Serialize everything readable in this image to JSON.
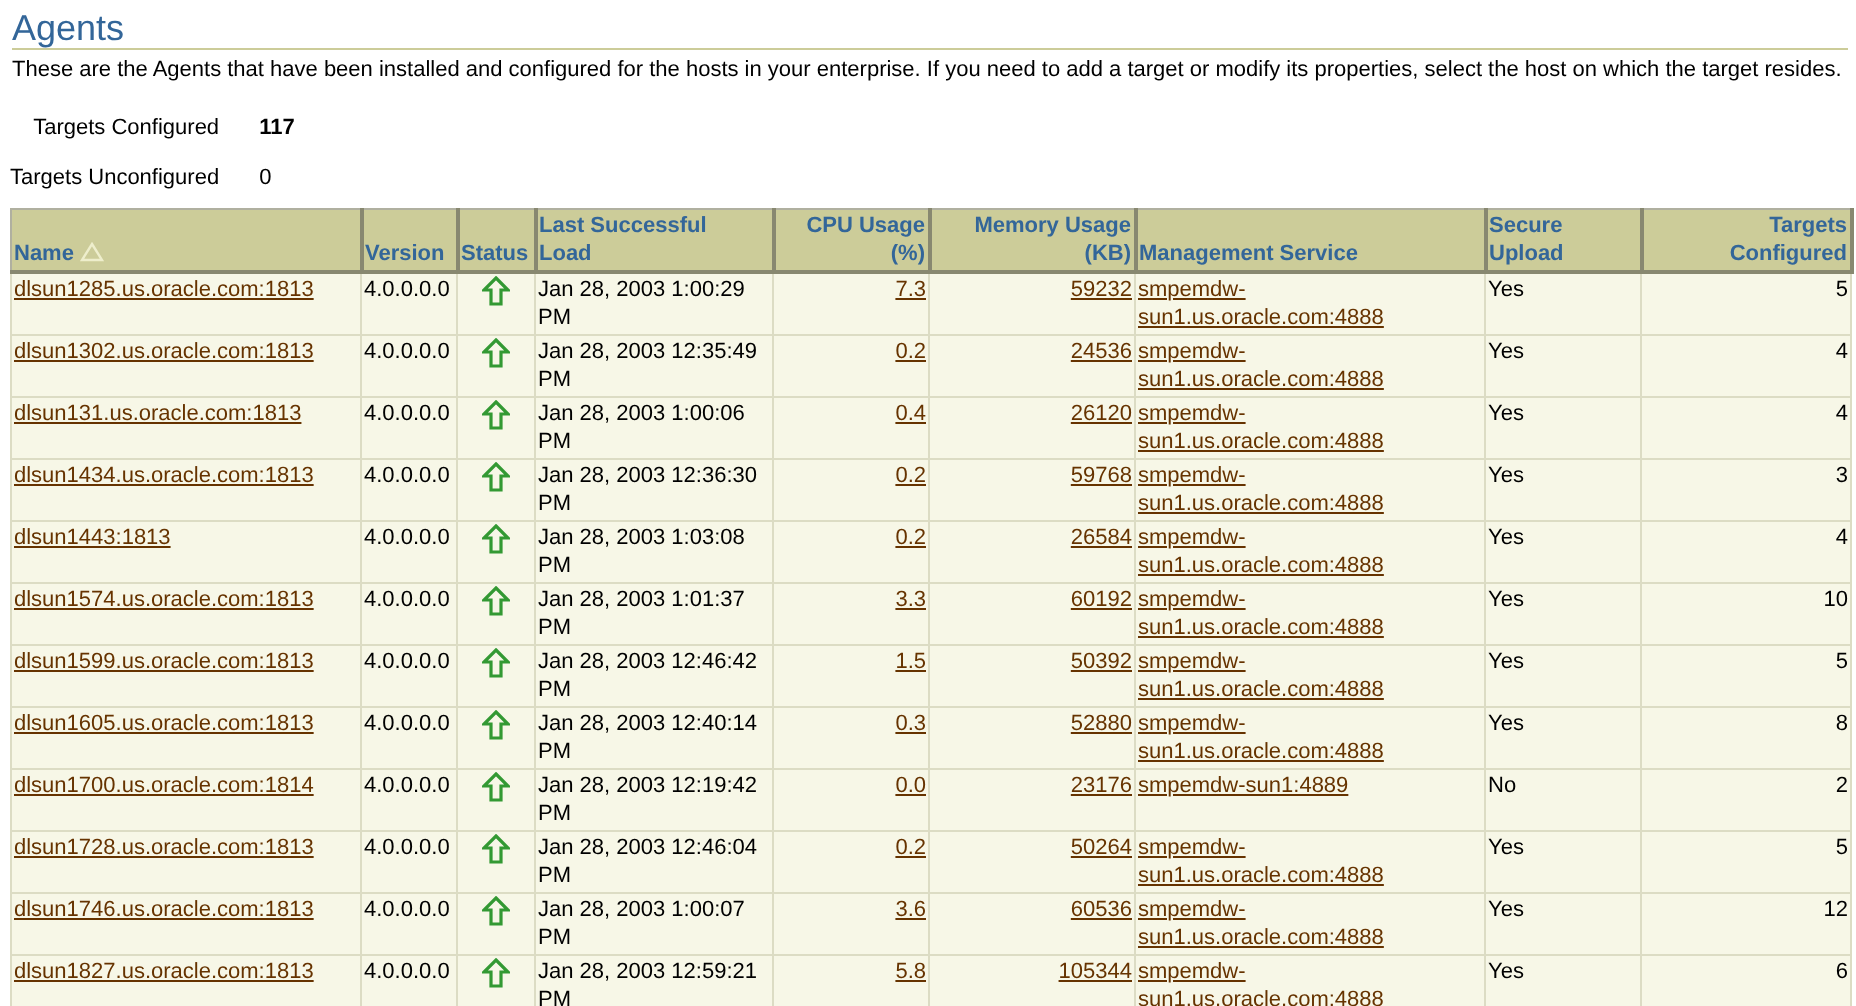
{
  "page": {
    "title": "Agents",
    "description": "These are the Agents that have been installed and configured for the hosts in your enterprise. If you need to add a target or modify its properties, select the host on which the target resides."
  },
  "summary": [
    {
      "label": "Targets Configured",
      "value": "117",
      "bold": true
    },
    {
      "label": "Targets Unconfigured",
      "value": "0",
      "bold": false
    }
  ],
  "table": {
    "columns": [
      {
        "label": "Name",
        "sorted": true
      },
      {
        "label": "Version",
        "sorted": false
      },
      {
        "label": "Status",
        "sorted": false
      },
      {
        "label": "Last Successful Load",
        "sorted": false
      },
      {
        "label": "CPU Usage (%)",
        "sorted": false
      },
      {
        "label": "Memory Usage (KB)",
        "sorted": false
      },
      {
        "label": "Management Service",
        "sorted": false
      },
      {
        "label": "Secure Upload",
        "sorted": false
      },
      {
        "label": "Targets Configured",
        "sorted": false
      }
    ],
    "rows": [
      {
        "name": "dlsun1285.us.oracle.com:1813",
        "version": "4.0.0.0.0",
        "last_load": "Jan 28, 2003 1:00:29 PM",
        "cpu": "7.3",
        "memory": "59232",
        "service": "smpemdw-sun1.us.oracle.com:4888",
        "secure_upload": "Yes",
        "targets": "5"
      },
      {
        "name": "dlsun1302.us.oracle.com:1813",
        "version": "4.0.0.0.0",
        "last_load": "Jan 28, 2003 12:35:49 PM",
        "cpu": "0.2",
        "memory": "24536",
        "service": "smpemdw-sun1.us.oracle.com:4888",
        "secure_upload": "Yes",
        "targets": "4"
      },
      {
        "name": "dlsun131.us.oracle.com:1813",
        "version": "4.0.0.0.0",
        "last_load": "Jan 28, 2003 1:00:06 PM",
        "cpu": "0.4",
        "memory": "26120",
        "service": "smpemdw-sun1.us.oracle.com:4888",
        "secure_upload": "Yes",
        "targets": "4"
      },
      {
        "name": "dlsun1434.us.oracle.com:1813",
        "version": "4.0.0.0.0",
        "last_load": "Jan 28, 2003 12:36:30 PM",
        "cpu": "0.2",
        "memory": "59768",
        "service": "smpemdw-sun1.us.oracle.com:4888",
        "secure_upload": "Yes",
        "targets": "3"
      },
      {
        "name": "dlsun1443:1813",
        "version": "4.0.0.0.0",
        "last_load": "Jan 28, 2003 1:03:08 PM",
        "cpu": "0.2",
        "memory": "26584",
        "service": "smpemdw-sun1.us.oracle.com:4888",
        "secure_upload": "Yes",
        "targets": "4"
      },
      {
        "name": "dlsun1574.us.oracle.com:1813",
        "version": "4.0.0.0.0",
        "last_load": "Jan 28, 2003 1:01:37 PM",
        "cpu": "3.3",
        "memory": "60192",
        "service": "smpemdw-sun1.us.oracle.com:4888",
        "secure_upload": "Yes",
        "targets": "10"
      },
      {
        "name": "dlsun1599.us.oracle.com:1813",
        "version": "4.0.0.0.0",
        "last_load": "Jan 28, 2003 12:46:42 PM",
        "cpu": "1.5",
        "memory": "50392",
        "service": "smpemdw-sun1.us.oracle.com:4888",
        "secure_upload": "Yes",
        "targets": "5"
      },
      {
        "name": "dlsun1605.us.oracle.com:1813",
        "version": "4.0.0.0.0",
        "last_load": "Jan 28, 2003 12:40:14 PM",
        "cpu": "0.3",
        "memory": "52880",
        "service": "smpemdw-sun1.us.oracle.com:4888",
        "secure_upload": "Yes",
        "targets": "8"
      },
      {
        "name": "dlsun1700.us.oracle.com:1814",
        "version": "4.0.0.0.0",
        "last_load": "Jan 28, 2003 12:19:42 PM",
        "cpu": "0.0",
        "memory": "23176",
        "service": "smpemdw-sun1:4889",
        "secure_upload": "No",
        "targets": "2"
      },
      {
        "name": "dlsun1728.us.oracle.com:1813",
        "version": "4.0.0.0.0",
        "last_load": "Jan 28, 2003 12:46:04 PM",
        "cpu": "0.2",
        "memory": "50264",
        "service": "smpemdw-sun1.us.oracle.com:4888",
        "secure_upload": "Yes",
        "targets": "5"
      },
      {
        "name": "dlsun1746.us.oracle.com:1813",
        "version": "4.0.0.0.0",
        "last_load": "Jan 28, 2003 1:00:07 PM",
        "cpu": "3.6",
        "memory": "60536",
        "service": "smpemdw-sun1.us.oracle.com:4888",
        "secure_upload": "Yes",
        "targets": "12"
      },
      {
        "name": "dlsun1827.us.oracle.com:1813",
        "version": "4.0.0.0.0",
        "last_load": "Jan 28, 2003 12:59:21 PM",
        "cpu": "5.8",
        "memory": "105344",
        "service": "smpemdw-sun1.us.oracle.com:4888",
        "secure_upload": "Yes",
        "targets": "6"
      }
    ]
  }
}
